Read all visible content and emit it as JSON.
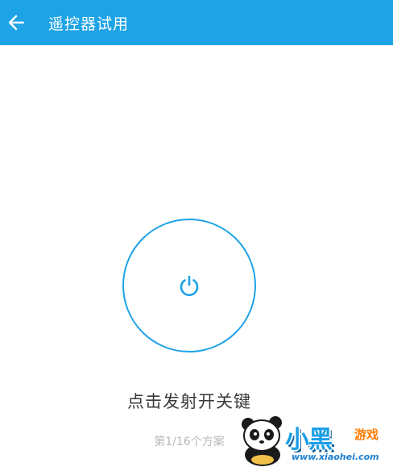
{
  "appbar": {
    "back_icon": "arrow-left-icon",
    "title": "遥控器试用",
    "background": "#1da3e6"
  },
  "remote": {
    "power_icon": "power-icon",
    "accent": "#1da3e6",
    "instruction": "点击发射开关键",
    "progress": "第1/16个方案"
  },
  "watermark": {
    "brand": "小黑",
    "sub": "游戏",
    "url": "www.xiaohei.com"
  }
}
